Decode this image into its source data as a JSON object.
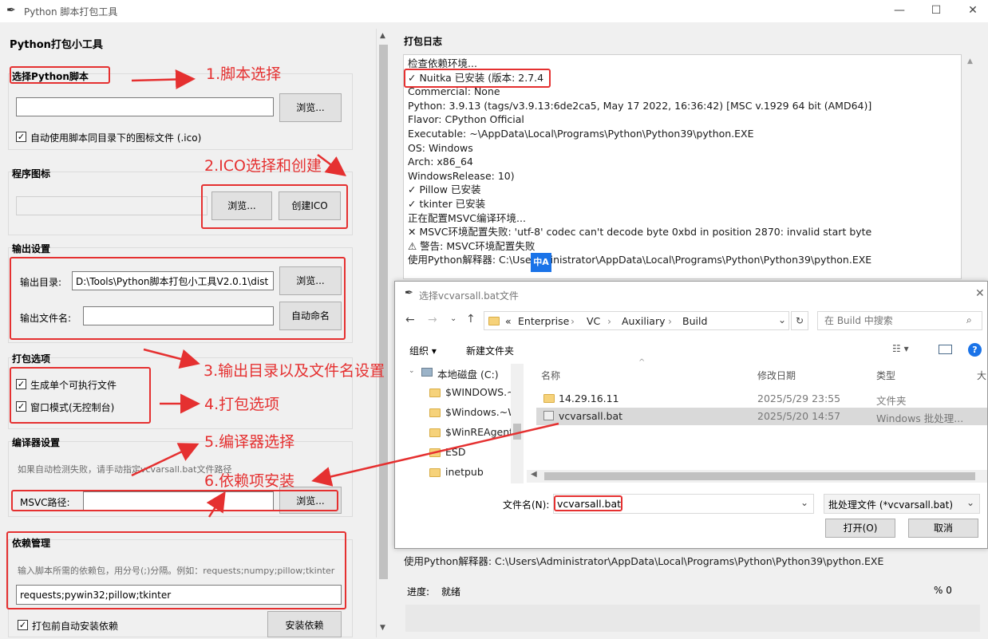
{
  "window": {
    "title": "Python 脚本打包工具",
    "minimize": "—",
    "maximize": "☐",
    "close": "✕"
  },
  "left": {
    "app_title": "Python打包小工具",
    "script_section": "选择Python脚本",
    "script_value": "",
    "browse": "浏览...",
    "auto_icon_label": "自动使用脚本同目录下的图标文件 (.ico)",
    "icon_section": "程序图标",
    "icon_browse": "浏览...",
    "create_ico": "创建ICO",
    "output_section": "输出设置",
    "out_dir_label": "输出目录:",
    "out_dir_value": "D:\\Tools\\Python脚本打包小工具V2.0.1\\dist",
    "out_dir_browse": "浏览...",
    "out_name_label": "输出文件名:",
    "out_name_value": "",
    "auto_name": "自动命名",
    "pack_section": "打包选项",
    "single_file": "生成单个可执行文件",
    "window_mode": "窗口模式(无控制台)",
    "compiler_section": "编译器设置",
    "compiler_hint": "如果自动检测失败，请手动指定vcvarsall.bat文件路径",
    "msvc_label": "MSVC路径:",
    "msvc_value": "",
    "msvc_browse": "浏览...",
    "deps_section": "依赖管理",
    "deps_hint": "输入脚本所需的依赖包，用分号(;)分隔。例如：requests;numpy;pillow;tkinter",
    "deps_value": "requests;pywin32;pillow;tkinter",
    "auto_install_label": "打包前自动安装依赖",
    "install_deps": "安装依赖"
  },
  "annotations": {
    "a1": "1.脚本选择",
    "a2": "2.ICO选择和创建",
    "a3": "3.输出目录以及文件名设置",
    "a4": "4.打包选项",
    "a5": "5.编译器选择",
    "a6": "6.依赖项安装",
    "accent": "#e53030"
  },
  "log": {
    "title": "打包日志",
    "lines": [
      "检查依赖环境...",
      "✓ Nuitka 已安装 (版本: 2.7.4",
      "Commercial: None",
      "Python: 3.9.13 (tags/v3.9.13:6de2ca5, May 17 2022, 16:36:42) [MSC v.1929 64 bit (AMD64)]",
      "Flavor: CPython Official",
      "Executable: ~\\AppData\\Local\\Programs\\Python\\Python39\\python.EXE",
      "OS: Windows",
      "Arch: x86_64",
      "WindowsRelease: 10)",
      "✓ Pillow 已安装",
      "✓ tkinter 已安装",
      "正在配置MSVC编译环境...",
      "✕ MSVC环境配置失败: 'utf-8' codec can't decode byte 0xbd in position 2870: invalid start byte",
      "⚠ 警告: MSVC环境配置失败",
      "使用Python解释器: C:\\Use    dministrator\\AppData\\Local\\Programs\\Python\\Python39\\python.EXE"
    ],
    "bottom_line": "使用Python解释器: C:\\Users\\Administrator\\AppData\\Local\\Programs\\Python\\Python39\\python.EXE",
    "progress_label": "进度:",
    "progress_status": "就绪",
    "progress_pct": "% 0",
    "progress": 0
  },
  "dialog": {
    "title": "选择vcvarsall.bat文件",
    "path": [
      "«",
      "Enterprise",
      "VC",
      "Auxiliary",
      "Build"
    ],
    "search_placeholder": "在 Build 中搜索",
    "organize": "组织 ▾",
    "new_folder": "新建文件夹",
    "tree": [
      "本地磁盘 (C:)",
      "$WINDOWS.~",
      "$Windows.~W",
      "$WinREAgent",
      "ESD",
      "inetpub"
    ],
    "columns": [
      "名称",
      "修改日期",
      "类型",
      "大"
    ],
    "files": [
      {
        "name": "14.29.16.11",
        "date": "2025/5/29 23:55",
        "type": "文件夹"
      },
      {
        "name": "vcvarsall.bat",
        "date": "2025/5/20 14:57",
        "type": "Windows 批处理..."
      }
    ],
    "filename_label": "文件名(N):",
    "filename_value": "vcvarsall.bat",
    "filter": "批处理文件 (*vcvarsall.bat)",
    "open": "打开(O)",
    "cancel": "取消"
  },
  "overlay_badge": "中A"
}
